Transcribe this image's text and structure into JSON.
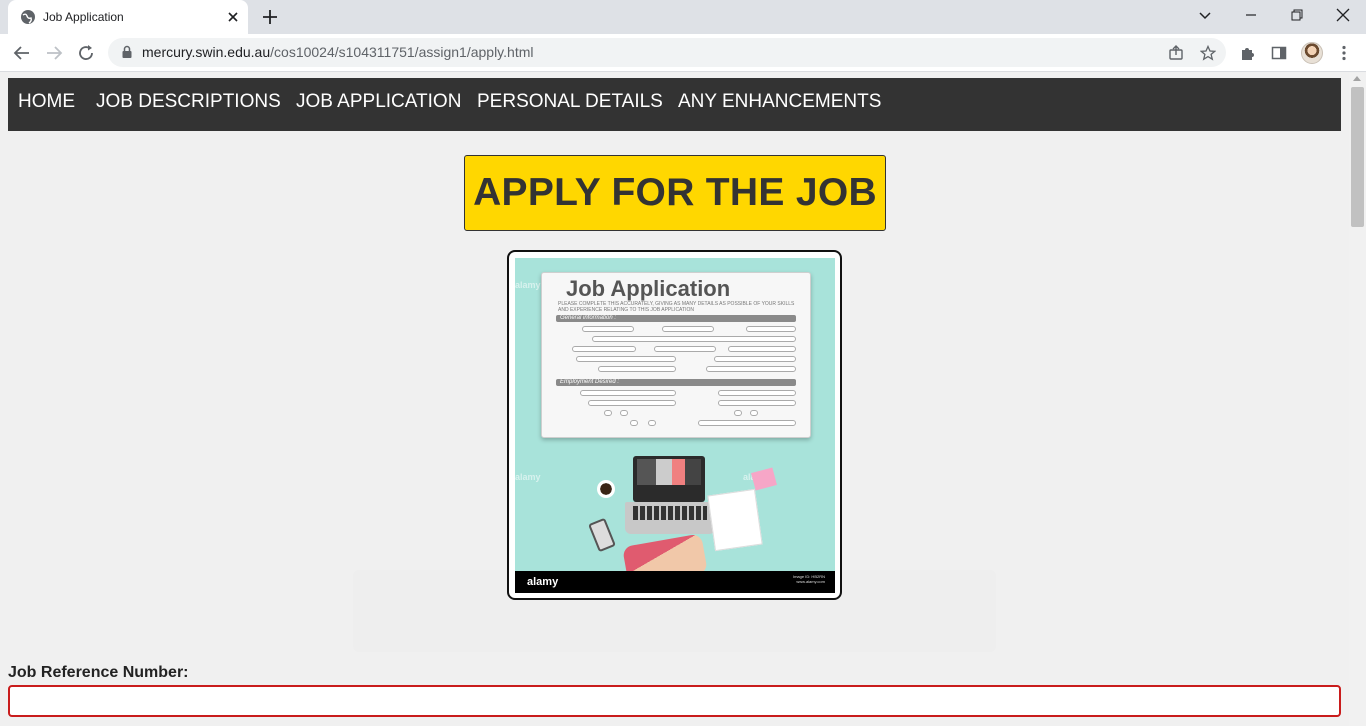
{
  "browser": {
    "tab": {
      "title": "Job Application",
      "favicon": "globe-icon"
    },
    "url": {
      "host": "mercury.swin.edu.au",
      "path": "/cos10024/s104311751/assign1/apply.html"
    },
    "icons": {
      "back": "back-arrow-icon",
      "forward": "forward-arrow-icon",
      "reload": "reload-icon",
      "lock": "lock-icon",
      "share": "share-icon",
      "bookmark": "star-icon",
      "extensions": "puzzle-icon",
      "sidepanel": "side-panel-icon",
      "menu": "kebab-menu-icon"
    }
  },
  "nav": {
    "items": [
      {
        "label": "HOME"
      },
      {
        "label": "JOB DESCRIPTIONS"
      },
      {
        "label": "JOB APPLICATION"
      },
      {
        "label": "PERSONAL DETAILS"
      },
      {
        "label": "ANY ENHANCEMENTS"
      }
    ]
  },
  "main": {
    "heading": "APPLY FOR THE JOB",
    "hero": {
      "paper_title": "Job Application",
      "paper_subtitle": "PLEASE COMPLETE THIS ACCURATELY, GIVING AS MANY DETAILS AS POSSIBLE OF YOUR SKILLS AND EXPERIENCE RELATING TO THIS JOB APPLICATION",
      "section_general": "General information :",
      "section_employment": "Employment Desired :",
      "logo": "alamy",
      "image_id": "Image ID: HB2RN",
      "site": "www.alamy.com",
      "watermark": "alamy"
    },
    "form": {
      "job_ref_label": "Job Reference Number:",
      "job_ref_value": ""
    }
  },
  "colors": {
    "nav_bg": "#333333",
    "banner_bg": "#ffd700",
    "input_border": "#c91c1c",
    "page_bg": "#f0f0f0"
  }
}
